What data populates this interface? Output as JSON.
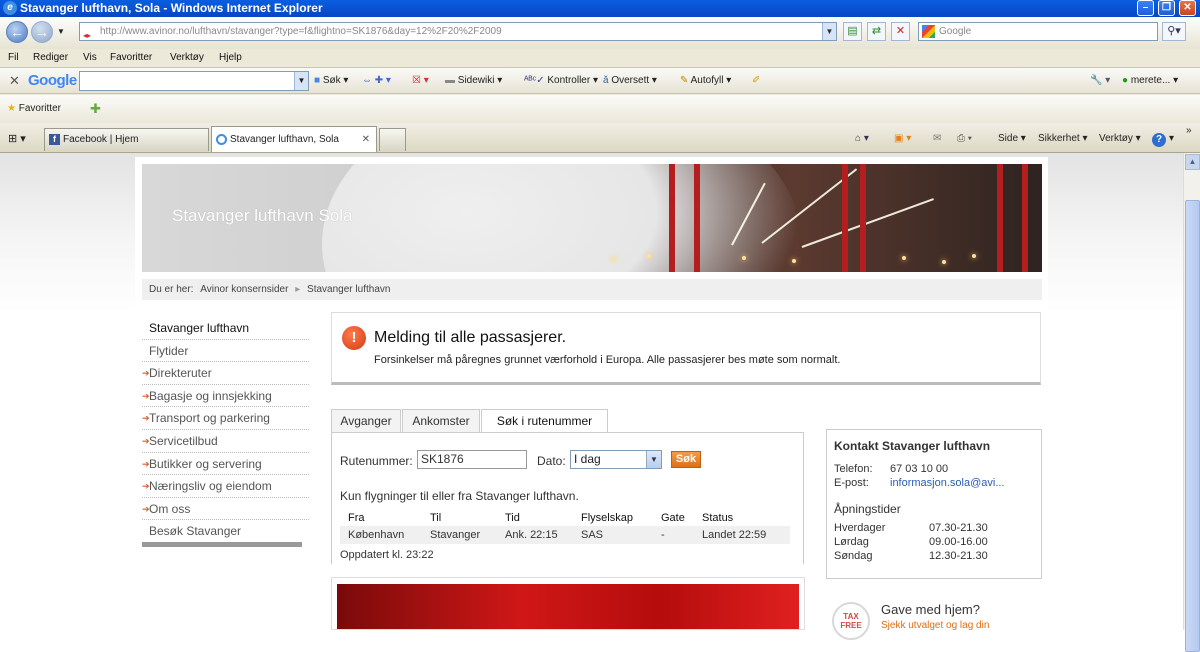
{
  "window": {
    "title": "Stavanger lufthavn, Sola - Windows Internet Explorer"
  },
  "address_bar": {
    "url": "http://www.avinor.no/lufthavn/stavanger?type=f&flightno=SK1876&day=12%2F20%2F2009"
  },
  "search_box": {
    "placeholder": "Google"
  },
  "menu": [
    "Fil",
    "Rediger",
    "Vis",
    "Favoritter",
    "Verktøy",
    "Hjelp"
  ],
  "google_toolbar": {
    "logo": "Google",
    "items": [
      "Søk",
      "Sidewiki",
      "Kontroller",
      "Oversett",
      "Autofyll"
    ],
    "user": "merete..."
  },
  "favorites_bar": {
    "label": "Favoritter"
  },
  "tabs": [
    {
      "label": "Facebook | Hjem"
    },
    {
      "label": "Stavanger lufthavn, Sola"
    }
  ],
  "command_bar": [
    "Side",
    "Sikkerhet",
    "Verktøy"
  ],
  "banner": {
    "title": "Stavanger lufthavn Sola"
  },
  "breadcrumb": {
    "prefix": "Du er her:",
    "items": [
      "Avinor konsernsider",
      "Stavanger lufthavn"
    ]
  },
  "left_nav": [
    {
      "label": "Stavanger lufthavn",
      "arrow": false
    },
    {
      "label": "Flytider",
      "arrow": false
    },
    {
      "label": "Direkteruter",
      "arrow": true
    },
    {
      "label": "Bagasje og innsjekking",
      "arrow": true
    },
    {
      "label": "Transport og parkering",
      "arrow": true
    },
    {
      "label": "Servicetilbud",
      "arrow": true
    },
    {
      "label": "Butikker og servering",
      "arrow": true
    },
    {
      "label": "Næringsliv og eiendom",
      "arrow": true
    },
    {
      "label": "Om oss",
      "arrow": true
    },
    {
      "label": "Besøk Stavanger",
      "arrow": false
    }
  ],
  "message": {
    "heading": "Melding til alle passasjerer.",
    "body": "Forsinkelser må påregnes grunnet værforhold i Europa. Alle passasjerer bes møte som normalt."
  },
  "page_tabs": [
    "Avganger",
    "Ankomster",
    "Søk i rutenummer"
  ],
  "search_form": {
    "route_label": "Rutenummer:",
    "route_value": "SK1876",
    "date_label": "Dato:",
    "date_value": "I dag",
    "button": "Søk",
    "note": "Kun flygninger til eller fra Stavanger lufthavn."
  },
  "flight_table": {
    "columns": [
      "Fra",
      "Til",
      "Tid",
      "Flyselskap",
      "Gate",
      "Status"
    ],
    "rows": [
      [
        "København",
        "Stavanger",
        "Ank. 22:15",
        "SAS",
        "-",
        "Landet 22:59"
      ]
    ]
  },
  "updated": "Oppdatert kl. 23:22",
  "contact": {
    "heading": "Kontakt Stavanger lufthavn",
    "phone_label": "Telefon:",
    "phone": "67 03 10 00",
    "email_label": "E-post:",
    "email": "informasjon.sola@avi...",
    "hours_heading": "Åpningstider",
    "hours": [
      {
        "day": "Hverdager",
        "time": "07.30-21.30"
      },
      {
        "day": "Lørdag",
        "time": "09.00-16.00"
      },
      {
        "day": "Søndag",
        "time": "12.30-21.30"
      }
    ]
  },
  "gift": {
    "title": "Gave med hjem?",
    "subtitle": "Sjekk utvalget og lag din",
    "badge": "TAX FREE"
  }
}
